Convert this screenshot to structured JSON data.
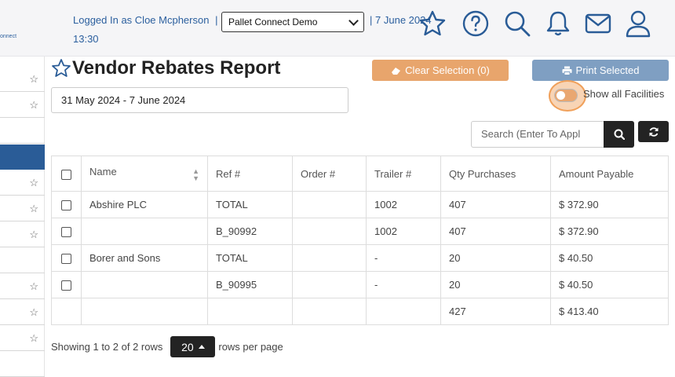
{
  "header": {
    "logo_text": "onnect",
    "logged_in_as": "Logged In as Cloe Mcpherson",
    "separator": "|",
    "facility_selected": "Pallet Connect Demo",
    "date_separator": "|",
    "date": "7 June 2024",
    "time": "13:30",
    "icons": [
      "star-icon",
      "help-icon",
      "search-icon",
      "bell-icon",
      "mail-icon",
      "user-icon"
    ]
  },
  "sidebar": {
    "items": [
      {
        "star": "☆"
      },
      {
        "star": "☆"
      },
      {
        "star": ""
      },
      {
        "star": ""
      },
      {
        "star": "☆"
      },
      {
        "star": "☆"
      },
      {
        "star": "☆"
      },
      {
        "star": ""
      },
      {
        "star": "☆"
      },
      {
        "star": "☆"
      },
      {
        "star": "☆"
      },
      {
        "star": ""
      }
    ]
  },
  "main": {
    "title": "Vendor Rebates Report",
    "clear_button": "Clear Selection (0)",
    "print_button": "Print Selected",
    "date_range": "31 May 2024 - 7 June 2024",
    "show_all_facilities_label": "Show all Facilities",
    "search_placeholder": "Search (Enter To Appl"
  },
  "table": {
    "columns": [
      "Name",
      "Ref #",
      "Order #",
      "Trailer #",
      "Qty Purchases",
      "Amount Payable"
    ],
    "rows": [
      {
        "name": "Abshire PLC",
        "ref": "TOTAL",
        "order": "",
        "trailer": "1002",
        "qty": "407",
        "amount": "$ 372.90"
      },
      {
        "name": "",
        "ref": "B_90992",
        "order": "",
        "trailer": "1002",
        "qty": "407",
        "amount": "$ 372.90"
      },
      {
        "name": "Borer and Sons",
        "ref": "TOTAL",
        "order": "",
        "trailer": "-",
        "qty": "20",
        "amount": "$ 40.50"
      },
      {
        "name": "",
        "ref": "B_90995",
        "order": "",
        "trailer": "-",
        "qty": "20",
        "amount": "$ 40.50"
      }
    ],
    "footer": {
      "qty": "427",
      "amount": "$ 413.40"
    }
  },
  "pager": {
    "showing": "Showing 1 to 2 of 2 rows",
    "page_size": "20",
    "rows_per_page": "rows per page"
  },
  "colors": {
    "accent_blue": "#2a5c97",
    "clear_orange": "#e8a56c",
    "print_blue": "#7f9fc2"
  }
}
